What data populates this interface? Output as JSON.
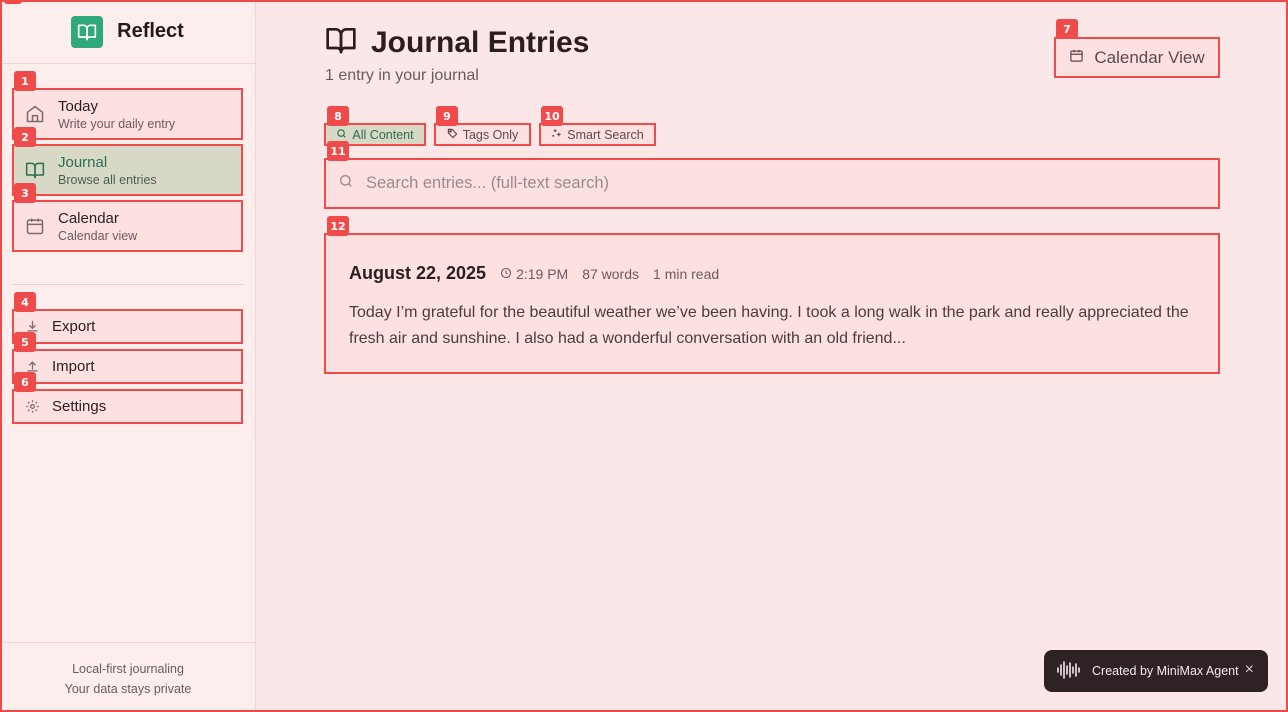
{
  "brand": {
    "name": "Reflect"
  },
  "sidebar": {
    "items": [
      {
        "badge": "1",
        "title": "Today",
        "subtitle": "Write your daily entry"
      },
      {
        "badge": "2",
        "title": "Journal",
        "subtitle": "Browse all entries"
      },
      {
        "badge": "3",
        "title": "Calendar",
        "subtitle": "Calendar view"
      }
    ],
    "actions": [
      {
        "badge": "4",
        "label": "Export"
      },
      {
        "badge": "5",
        "label": "Import"
      },
      {
        "badge": "6",
        "label": "Settings"
      }
    ],
    "footer_line1": "Local-first journaling",
    "footer_line2": "Your data stays private"
  },
  "header": {
    "title": "Journal Entries",
    "subtitle": "1 entry in your journal",
    "calendar_badge": "7",
    "calendar_label": "Calendar View"
  },
  "filters": [
    {
      "badge": "8",
      "label": "All Content"
    },
    {
      "badge": "9",
      "label": "Tags Only"
    },
    {
      "badge": "10",
      "label": "Smart Search"
    }
  ],
  "search": {
    "badge": "11",
    "placeholder": "Search entries... (full-text search)"
  },
  "entries": [
    {
      "badge": "12",
      "date": "August 22, 2025",
      "time": "2:19 PM",
      "words": "87 words",
      "read": "1 min read",
      "excerpt": "Today I’m grateful for the beautiful weather we’ve been having. I took a long walk in the park and really appreciated the fresh air and sunshine. I also had a wonderful conversation with an old friend..."
    }
  ],
  "toast": {
    "label": "Created by MiniMax Agent",
    "close": "×"
  },
  "colors": {
    "accent": "#2fa87a",
    "highlight": "#ef4b4b",
    "active_bg": "#d7d8c5"
  }
}
